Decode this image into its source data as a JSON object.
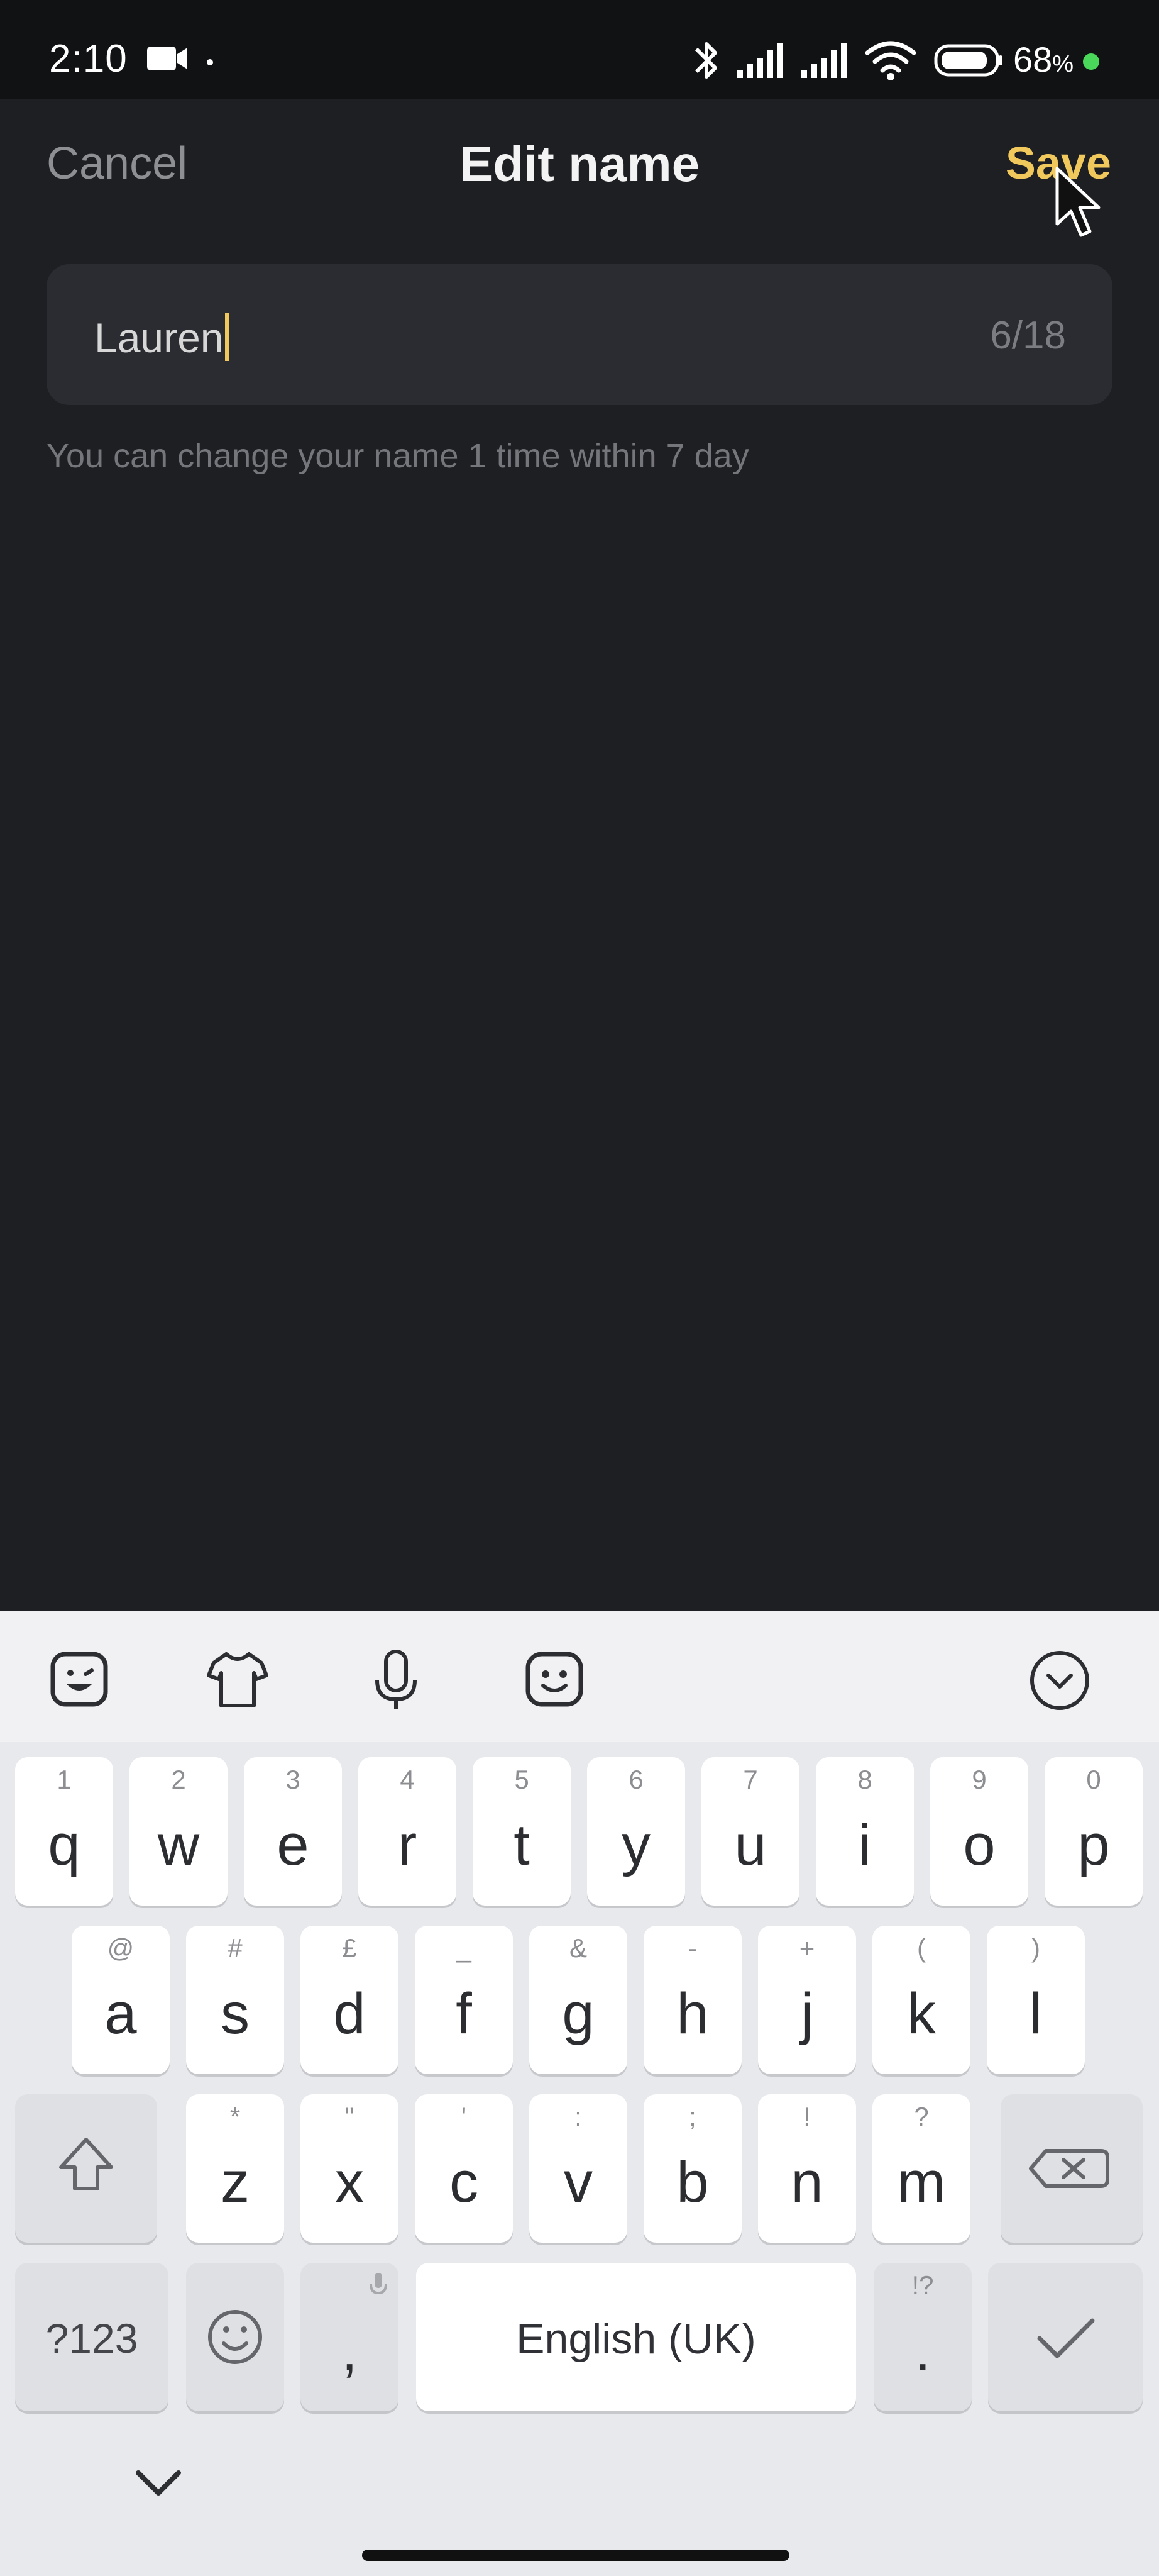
{
  "status_bar": {
    "time": "2:10",
    "battery": "68"
  },
  "header": {
    "cancel": "Cancel",
    "title": "Edit name",
    "save": "Save"
  },
  "field": {
    "value": "Lauren",
    "counter": "6/18"
  },
  "hint": "You can change your name 1 time within 7 day",
  "keyboard": {
    "row1": [
      {
        "num": "1",
        "letter": "q"
      },
      {
        "num": "2",
        "letter": "w"
      },
      {
        "num": "3",
        "letter": "e"
      },
      {
        "num": "4",
        "letter": "r"
      },
      {
        "num": "5",
        "letter": "t"
      },
      {
        "num": "6",
        "letter": "y"
      },
      {
        "num": "7",
        "letter": "u"
      },
      {
        "num": "8",
        "letter": "i"
      },
      {
        "num": "9",
        "letter": "o"
      },
      {
        "num": "0",
        "letter": "p"
      }
    ],
    "row2": [
      {
        "sym": "@",
        "letter": "a"
      },
      {
        "sym": "#",
        "letter": "s"
      },
      {
        "sym": "£",
        "letter": "d"
      },
      {
        "sym": "_",
        "letter": "f"
      },
      {
        "sym": "&",
        "letter": "g"
      },
      {
        "sym": "-",
        "letter": "h"
      },
      {
        "sym": "+",
        "letter": "j"
      },
      {
        "sym": "(",
        "letter": "k"
      },
      {
        "sym": ")",
        "letter": "l"
      }
    ],
    "row3": [
      {
        "sym": "*",
        "letter": "z"
      },
      {
        "sym": "\"",
        "letter": "x"
      },
      {
        "sym": "'",
        "letter": "c"
      },
      {
        "sym": ":",
        "letter": "v"
      },
      {
        "sym": ";",
        "letter": "b"
      },
      {
        "sym": "!",
        "letter": "n"
      },
      {
        "sym": "?",
        "letter": "m"
      }
    ],
    "sym_key": "?123",
    "comma": ",",
    "space": "English (UK)",
    "period_sub": "!?",
    "period": "."
  },
  "colors": {
    "accent": "#f0c85c",
    "background": "#1e1f23"
  }
}
